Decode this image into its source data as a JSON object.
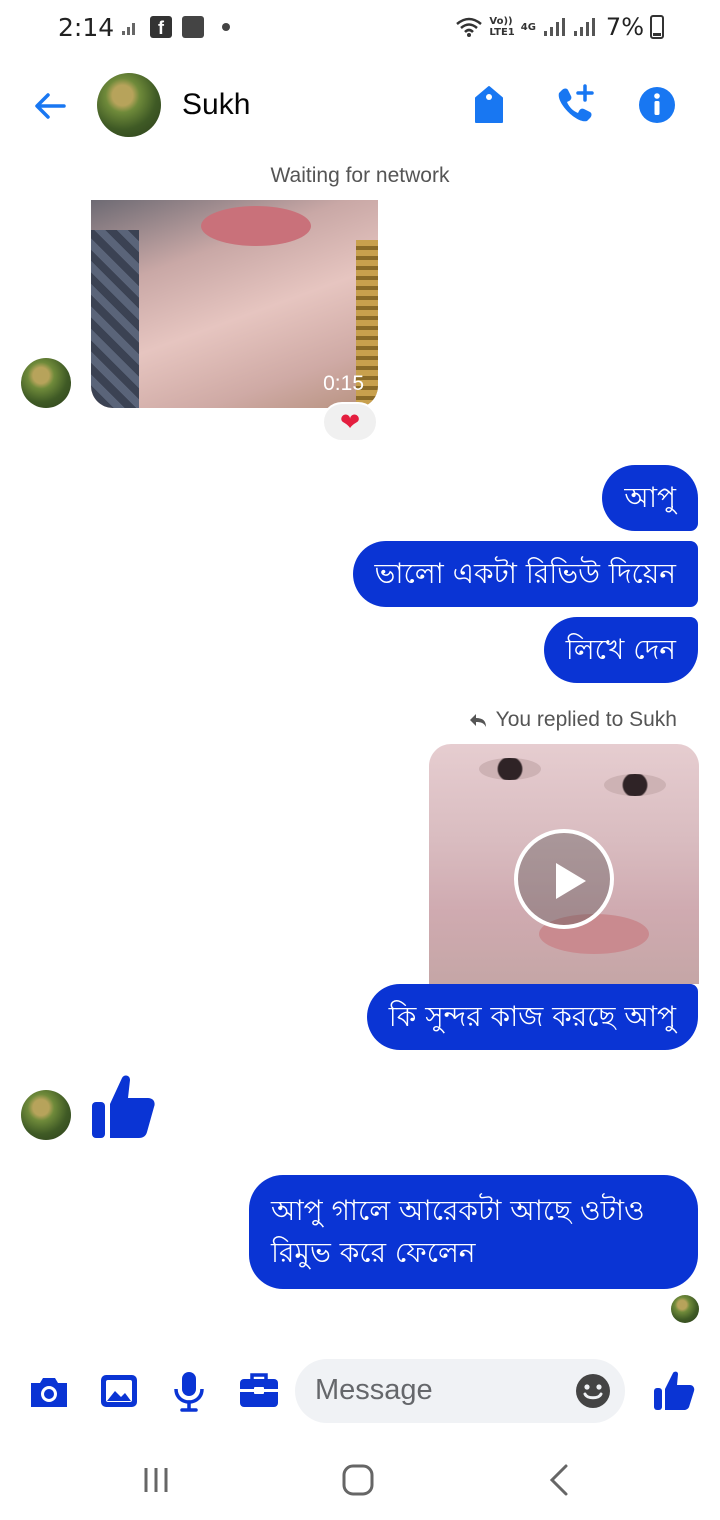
{
  "status_bar": {
    "time": "2:14",
    "labels": [
      "Vo))",
      "LTE1"
    ],
    "network": "4G",
    "battery": "7%"
  },
  "header": {
    "name": "Sukh"
  },
  "chat": {
    "waiting_notice": "Waiting for network",
    "video_duration": "0:15",
    "reaction": "❤",
    "sent_messages": [
      "আপু",
      "ভালো একটা রিভিউ দিয়েন",
      "লিখে দেন"
    ],
    "reply_label": "You replied to Sukh",
    "reply_message": "কি সুন্দর কাজ করছে আপু",
    "last_message_line1": "আপু গালে আরেকটা আছে ওটাও",
    "last_message_line2": "রিমুভ করে ফেলেন"
  },
  "composer": {
    "placeholder": "Message"
  },
  "colors": {
    "accent": "#0a34d4",
    "header_icon": "#1877f2"
  },
  "icons": [
    "back-arrow-icon",
    "tag-icon",
    "add-call-icon",
    "info-icon",
    "camera-icon",
    "gallery-icon",
    "mic-icon",
    "briefcase-icon",
    "emoji-icon",
    "thumbs-up-icon"
  ]
}
